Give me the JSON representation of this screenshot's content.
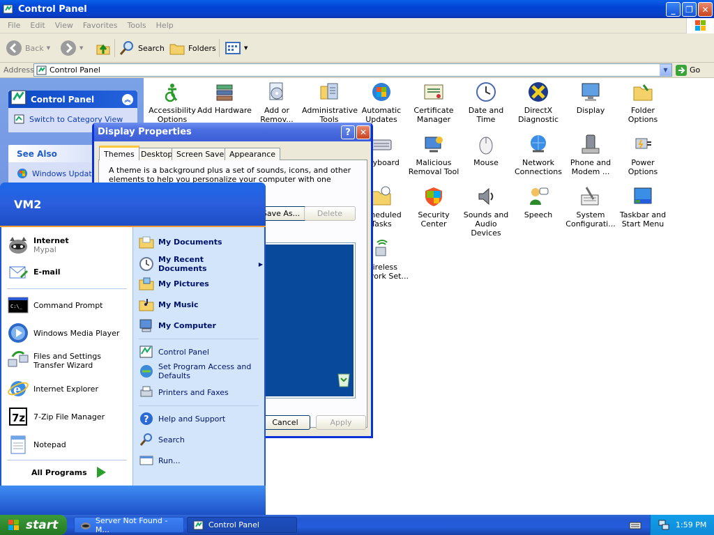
{
  "window": {
    "title": "Control Panel",
    "minimize": "_",
    "maximize": "❐",
    "close": "✕"
  },
  "menu": [
    "File",
    "Edit",
    "View",
    "Favorites",
    "Tools",
    "Help"
  ],
  "toolbar": {
    "back": "Back",
    "search": "Search",
    "folders": "Folders"
  },
  "address": {
    "label": "Address",
    "value": "Control Panel",
    "go": "Go"
  },
  "sidepane": {
    "header": "Control Panel",
    "switch_link": "Switch to Category View",
    "see_also": "See Also",
    "windows_update": "Windows Update"
  },
  "icons": [
    {
      "label": "Accessibility Options",
      "icon": "accessibility-icon"
    },
    {
      "label": "Add Hardware",
      "icon": "add-hardware-icon"
    },
    {
      "label": "Add or Remov...",
      "icon": "add-remove-programs-icon"
    },
    {
      "label": "Administrative Tools",
      "icon": "admin-tools-icon"
    },
    {
      "label": "Automatic Updates",
      "icon": "automatic-updates-icon"
    },
    {
      "label": "Certificate Manager",
      "icon": "certificate-icon"
    },
    {
      "label": "Date and Time",
      "icon": "clock-icon"
    },
    {
      "label": "DirectX Diagnostic",
      "icon": "directx-icon"
    },
    {
      "label": "Display",
      "icon": "display-icon"
    },
    {
      "label": "Folder Options",
      "icon": "folder-options-icon"
    },
    {
      "label": "Keyboard",
      "icon": "keyboard-icon"
    },
    {
      "label": "Malicious Removal Tool",
      "icon": "malicious-removal-icon"
    },
    {
      "label": "Mouse",
      "icon": "mouse-icon"
    },
    {
      "label": "Network Connections",
      "icon": "network-icon"
    },
    {
      "label": "Phone and Modem ...",
      "icon": "phone-modem-icon"
    },
    {
      "label": "Power Options",
      "icon": "power-options-icon"
    },
    {
      "label": "Scheduled Tasks",
      "icon": "scheduled-tasks-icon"
    },
    {
      "label": "Security Center",
      "icon": "security-center-icon"
    },
    {
      "label": "Sounds and Audio Devices",
      "icon": "sounds-icon"
    },
    {
      "label": "Speech",
      "icon": "speech-icon"
    },
    {
      "label": "System Configurati...",
      "icon": "system-config-icon"
    },
    {
      "label": "Taskbar and Start Menu",
      "icon": "taskbar-icon"
    },
    {
      "label": "Wireless Network Set...",
      "icon": "wireless-icon"
    }
  ],
  "display_props": {
    "title": "Display Properties",
    "tabs": [
      "Themes",
      "Desktop",
      "Screen Saver",
      "Appearance"
    ],
    "desc": "A theme is a background plus a set of sounds, icons, and other elements to help you personalize your computer with one click.",
    "save_as": "Save As...",
    "delete": "Delete",
    "cancel": "Cancel",
    "apply": "Apply"
  },
  "start_menu": {
    "user": "VM2",
    "pinned": [
      {
        "label": "Internet",
        "sub": "Mypal"
      },
      {
        "label": "E-mail",
        "sub": ""
      }
    ],
    "recent": [
      "Command Prompt",
      "Windows Media Player",
      "Files and Settings Transfer Wizard",
      "Internet Explorer",
      "7-Zip File Manager",
      "Notepad"
    ],
    "all_programs": "All Programs",
    "right": [
      "My Documents",
      "My Recent Documents",
      "My Pictures",
      "My Music",
      "My Computer",
      "Control Panel",
      "Set Program Access and Defaults",
      "Printers and Faxes",
      "Help and Support",
      "Search",
      "Run..."
    ]
  },
  "taskbar": {
    "start": "start",
    "tasks": [
      "Server Not Found - M...",
      "Control Panel"
    ],
    "time": "1:59 PM"
  }
}
